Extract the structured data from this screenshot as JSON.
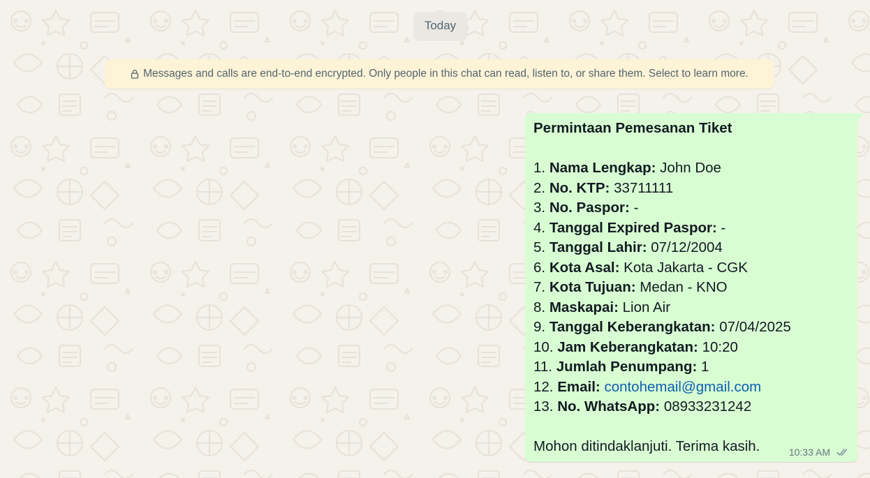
{
  "chat": {
    "date_label": "Today",
    "encryption_notice": "Messages and calls are end-to-end encrypted. Only people in this chat can read, listen to, or share them. Select to learn more.",
    "notice_icon": "lock-icon"
  },
  "message": {
    "direction": "outgoing",
    "title": "Permintaan Pemesanan Tiket",
    "items": [
      {
        "num": "1.",
        "label": "Nama Lengkap:",
        "value": "John Doe"
      },
      {
        "num": "2.",
        "label": "No. KTP:",
        "value": "33711111"
      },
      {
        "num": "3.",
        "label": "No. Paspor:",
        "value": "-"
      },
      {
        "num": "4.",
        "label": "Tanggal Expired Paspor:",
        "value": "-"
      },
      {
        "num": "5.",
        "label": "Tanggal Lahir:",
        "value": "07/12/2004"
      },
      {
        "num": "6.",
        "label": "Kota Asal:",
        "value": "Kota Jakarta - CGK"
      },
      {
        "num": "7.",
        "label": "Kota Tujuan:",
        "value": "Medan - KNO"
      },
      {
        "num": "8.",
        "label": "Maskapai:",
        "value": "Lion Air"
      },
      {
        "num": "9.",
        "label": "Tanggal Keberangkatan:",
        "value": "07/04/2025"
      },
      {
        "num": "10.",
        "label": "Jam Keberangkatan:",
        "value": "10:20"
      },
      {
        "num": "11.",
        "label": "Jumlah Penumpang:",
        "value": "1"
      },
      {
        "num": "12.",
        "label": "Email:",
        "value": "contohemail@gmail.com"
      },
      {
        "num": "13.",
        "label": "No. WhatsApp:",
        "value": "08933231242"
      }
    ],
    "closing": "Mohon ditindaklanjuti. Terima kasih.",
    "time": "10:33 AM",
    "status_icon": "double-check-icon"
  },
  "colors": {
    "chat_background": "#f5f1eb",
    "outgoing_bubble": "#d9fdd3",
    "notice_background": "#fdf3d6",
    "link": "#0d5fb3",
    "read_ticks": "#8696a0"
  }
}
